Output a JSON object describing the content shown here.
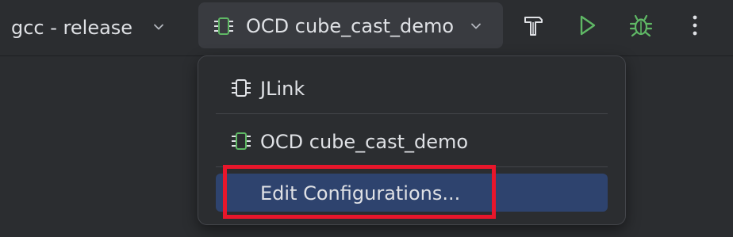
{
  "toolbar": {
    "build_profile": "gcc - release",
    "run_config": "OCD cube_cast_demo",
    "actions": [
      "hammer-icon",
      "run-icon",
      "debug-icon",
      "more-icon"
    ]
  },
  "dropdown": {
    "items": [
      {
        "label": "JLink",
        "icon": "chip-icon"
      },
      {
        "label": "OCD cube_cast_demo",
        "icon": "chip-icon"
      },
      {
        "label": "Edit Configurations..."
      }
    ]
  },
  "colors": {
    "background": "#2b2d30",
    "text": "#dfe1e5",
    "selected": "#2e436e",
    "run_green": "#5fb865",
    "chip_green": "#5fb865",
    "highlight_red": "#e8162b"
  }
}
